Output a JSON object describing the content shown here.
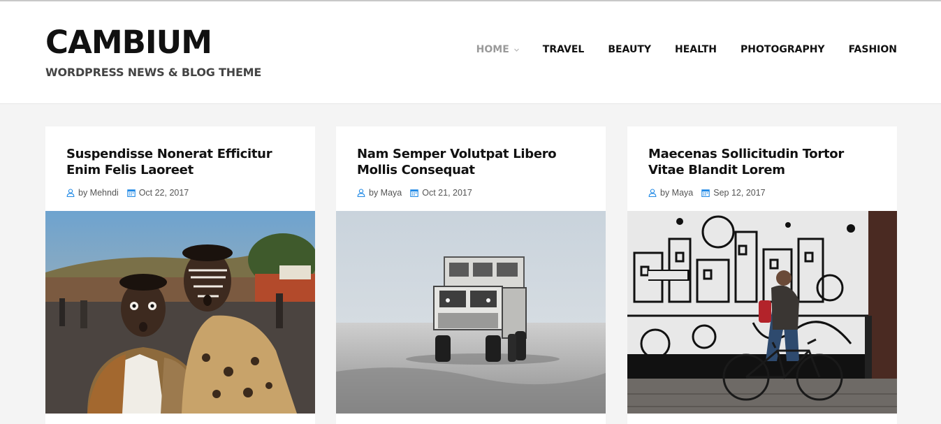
{
  "site": {
    "title": "CAMBIUM",
    "tagline": "WORDPRESS NEWS & BLOG THEME"
  },
  "nav": {
    "items": [
      {
        "label": "HOME",
        "active": true,
        "has_dropdown": true
      },
      {
        "label": "TRAVEL"
      },
      {
        "label": "BEAUTY"
      },
      {
        "label": "HEALTH"
      },
      {
        "label": "PHOTOGRAPHY"
      },
      {
        "label": "FASHION"
      }
    ]
  },
  "posts": [
    {
      "title": "Suspendisse Nonerat Efficitur Enim Felis Laoreet",
      "author": "by Mehndi",
      "date": "Oct 22, 2017",
      "image": "two people with painted faces at a street market"
    },
    {
      "title": "Nam Semper Volutpat Libero Mollis Consequat",
      "author": "by Maya",
      "date": "Oct 21, 2017",
      "image": "large off-road truck driving on snowy terrain"
    },
    {
      "title": "Maecenas Sollicitudin Tortor Vitae Blandit Lorem",
      "author": "by Maya",
      "date": "Sep 12, 2017",
      "image": "man walking a bicycle past black and white graffiti mural"
    }
  ],
  "colors": {
    "accent": "#1e88e5",
    "text": "#111111",
    "muted": "#9a9a9a",
    "background": "#f4f4f4"
  }
}
